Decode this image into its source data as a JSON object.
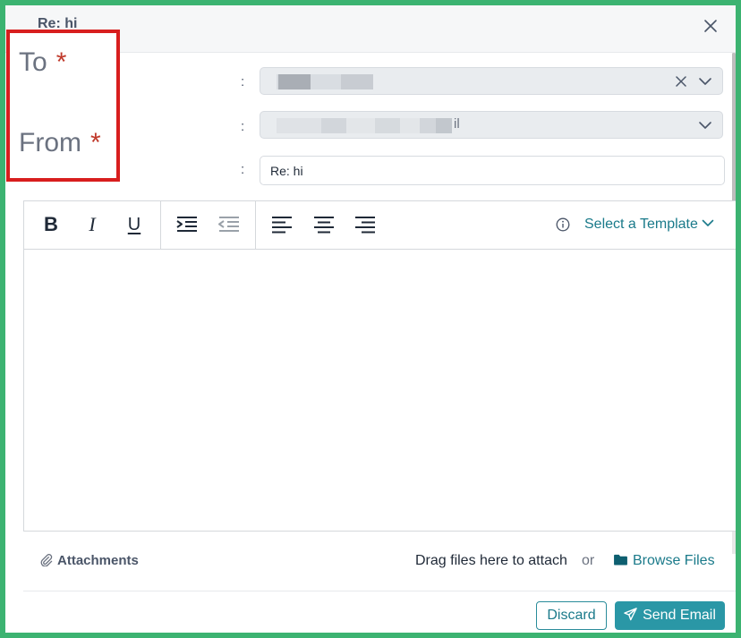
{
  "dialog": {
    "title": "Re: hi",
    "close_label": "×"
  },
  "fields": {
    "colon": ":",
    "to": {
      "label": "To",
      "required_marker": "*"
    },
    "from": {
      "label": "From",
      "required_marker": "*",
      "value_suffix": "il"
    },
    "subject": {
      "value": "Re: hi"
    }
  },
  "toolbar": {
    "bold": "B",
    "italic": "I",
    "underline": "U",
    "template_label": "Select a Template"
  },
  "attachments": {
    "label": "Attachments",
    "drag_text": "Drag files here to attach",
    "or_text": "or",
    "browse_label": "Browse Files"
  },
  "footer": {
    "discard_label": "Discard",
    "send_label": "Send Email"
  },
  "colors": {
    "accent": "#2a97a6",
    "link": "#1a7a8a",
    "highlight": "#d81e1e",
    "frame": "#3cb371"
  },
  "icons": [
    "close-icon",
    "clear-icon",
    "chevron-down-icon",
    "bold-icon",
    "italic-icon",
    "underline-icon",
    "indent-icon",
    "outdent-icon",
    "align-left-icon",
    "align-center-icon",
    "align-right-icon",
    "info-icon",
    "paperclip-icon",
    "folder-icon",
    "send-icon"
  ]
}
